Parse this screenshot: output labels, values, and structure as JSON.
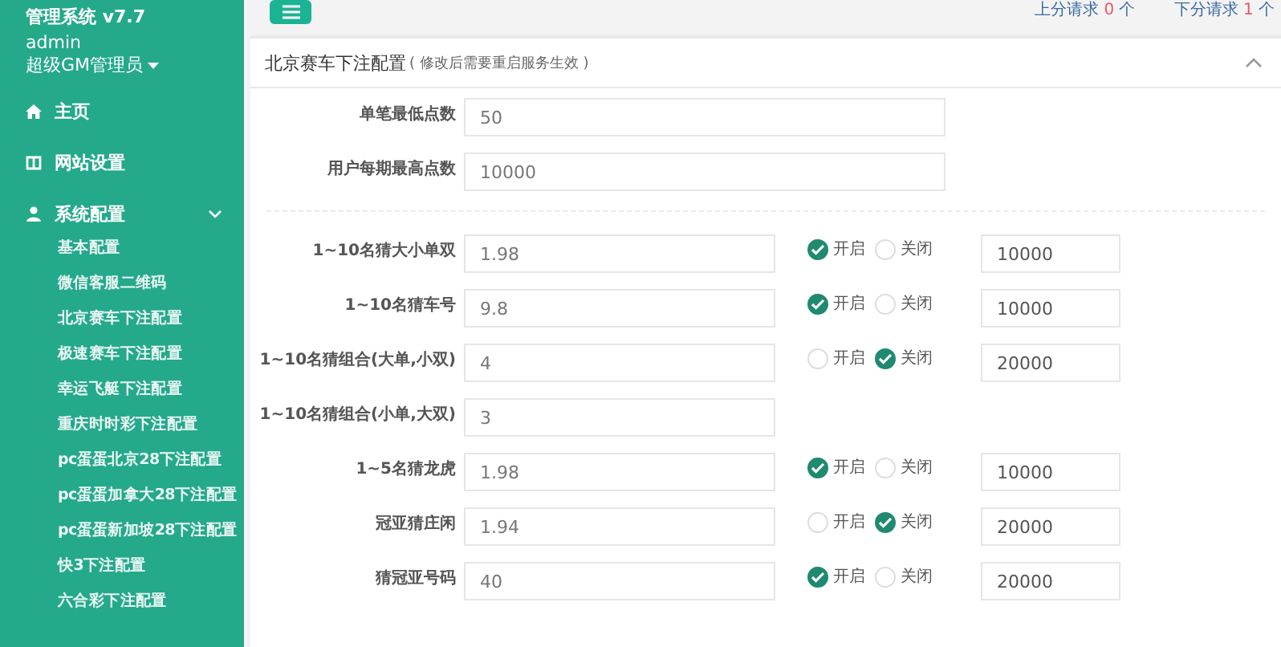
{
  "sidebar": {
    "title": "管理系统 v7.7",
    "user": "admin",
    "role": "超级GM管理员",
    "items": [
      {
        "label": "主页"
      },
      {
        "label": "网站设置"
      },
      {
        "label": "系统配置",
        "expanded": true,
        "children": [
          {
            "label": "基本配置"
          },
          {
            "label": "微信客服二维码"
          },
          {
            "label": "北京赛车下注配置"
          },
          {
            "label": "极速赛车下注配置"
          },
          {
            "label": "幸运飞艇下注配置"
          },
          {
            "label": "重庆时时彩下注配置"
          },
          {
            "label": "pc蛋蛋北京28下注配置"
          },
          {
            "label": "pc蛋蛋加拿大28下注配置"
          },
          {
            "label": "pc蛋蛋新加坡28下注配置"
          },
          {
            "label": "快3下注配置"
          },
          {
            "label": "六合彩下注配置"
          }
        ]
      }
    ]
  },
  "topbar": {
    "requests": [
      {
        "label": "上分请求",
        "count": "0",
        "unit": "个"
      },
      {
        "label": "下分请求",
        "count": "1",
        "unit": "个"
      }
    ]
  },
  "panel": {
    "title": "北京赛车下注配置",
    "note": "( 修改后需要重启服务生效 )",
    "general": [
      {
        "label": "单笔最低点数",
        "value": "50"
      },
      {
        "label": "用户每期最高点数",
        "value": "10000"
      }
    ],
    "odds": [
      {
        "kind": "full",
        "label": "1~10名猜大小单双",
        "value": "1.98",
        "on": true,
        "on_label": "开启",
        "off_label": "关闭",
        "limit": "10000"
      },
      {
        "kind": "full",
        "label": "1~10名猜车号",
        "value": "9.8",
        "on": true,
        "on_label": "开启",
        "off_label": "关闭",
        "limit": "10000"
      },
      {
        "kind": "full",
        "label": "1~10名猜组合(大单,小双)",
        "value": "4",
        "on": false,
        "on_label": "开启",
        "off_label": "关闭",
        "limit": "20000"
      },
      {
        "kind": "simple",
        "label": "1~10名猜组合(小单,大双)",
        "value": "3"
      },
      {
        "kind": "full",
        "label": "1~5名猜龙虎",
        "value": "1.98",
        "on": true,
        "on_label": "开启",
        "off_label": "关闭",
        "limit": "10000"
      },
      {
        "kind": "full",
        "label": "冠亚猜庄闲",
        "value": "1.94",
        "on": false,
        "on_label": "开启",
        "off_label": "关闭",
        "limit": "20000"
      },
      {
        "kind": "full",
        "label": "猜冠亚号码",
        "value": "40",
        "on": true,
        "on_label": "开启",
        "off_label": "关闭",
        "limit": "20000"
      }
    ]
  }
}
